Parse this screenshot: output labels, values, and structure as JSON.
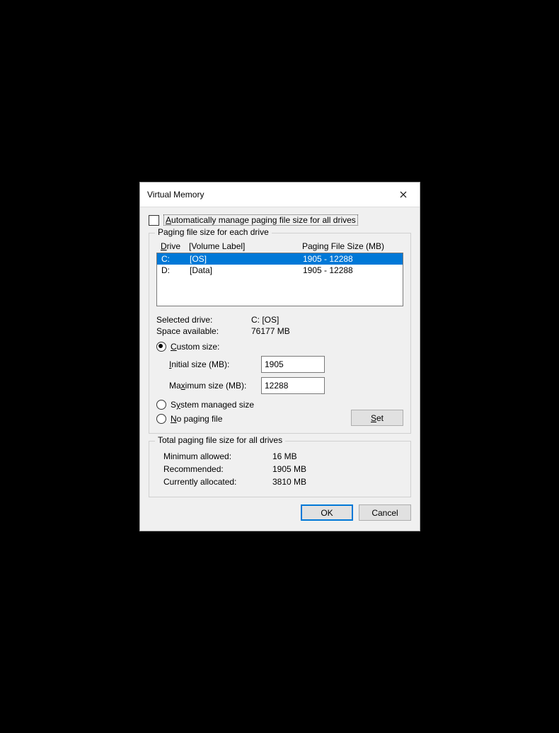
{
  "dialog": {
    "title": "Virtual Memory",
    "auto_manage_label": "Automatically manage paging file size for all drives",
    "auto_manage_accessprefix": "A"
  },
  "group1": {
    "title": "Paging file size for each drive",
    "headers": {
      "drive": "Drive",
      "volume": "[Volume Label]",
      "paging": "Paging File Size (MB)"
    },
    "rows": [
      {
        "drive": "C:",
        "volume": "[OS]",
        "paging": "1905 - 12288",
        "selected": true
      },
      {
        "drive": "D:",
        "volume": "[Data]",
        "paging": "1905 - 12288",
        "selected": false
      }
    ],
    "selected_label": "Selected drive:",
    "selected_value": "C:  [OS]",
    "space_label": "Space available:",
    "space_value": "76177 MB",
    "radio_custom": "Custom size:",
    "initial_label": "Initial size (MB):",
    "initial_value": "1905",
    "maximum_label": "Maximum size (MB):",
    "maximum_value": "12288",
    "radio_system": "System managed size",
    "radio_none": "No paging file",
    "set_label": "Set"
  },
  "group2": {
    "title": "Total paging file size for all drives",
    "min_label": "Minimum allowed:",
    "min_value": "16 MB",
    "rec_label": "Recommended:",
    "rec_value": "1905 MB",
    "cur_label": "Currently allocated:",
    "cur_value": "3810 MB"
  },
  "buttons": {
    "ok": "OK",
    "cancel": "Cancel"
  }
}
